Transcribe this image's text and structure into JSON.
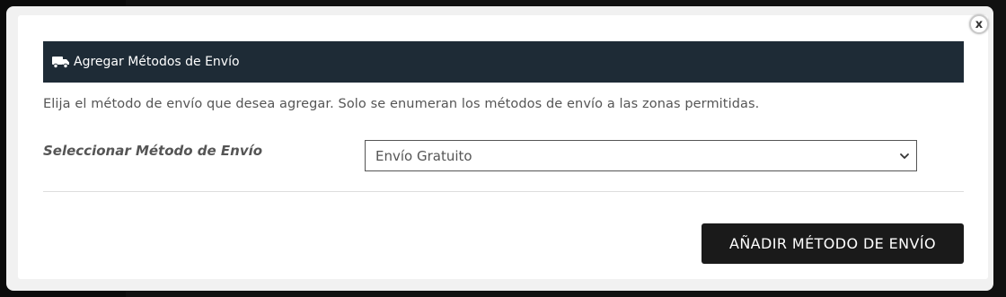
{
  "dialog": {
    "close_label": "x",
    "header": {
      "icon": "truck-icon",
      "title": "Agregar Métodos de Envío"
    },
    "description": "Elija el método de envío que desea agregar. Solo se enumeran los métodos de envío a las zonas permitidas.",
    "field": {
      "label": "Seleccionar Método de Envío",
      "selected_value": "Envío Gratuito"
    },
    "submit_label": "AÑADIR MÉTODO DE ENVÍO"
  },
  "colors": {
    "header_bg": "#1e2b36",
    "button_bg": "#1a1a1a",
    "text_muted": "#555555"
  }
}
